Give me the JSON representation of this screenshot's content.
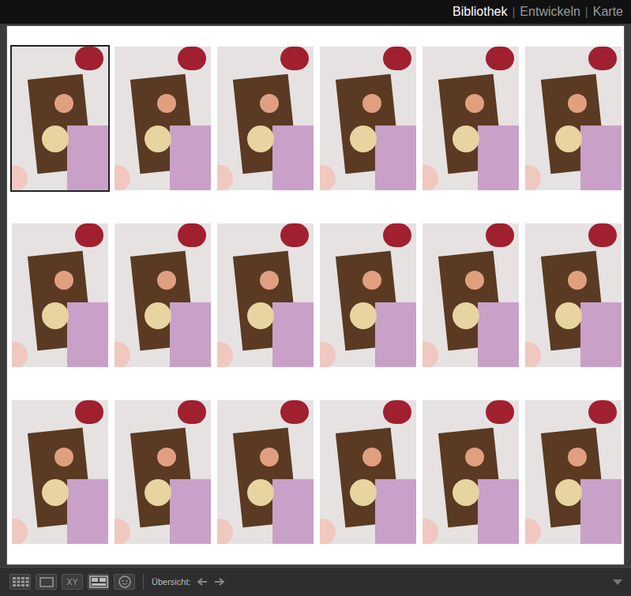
{
  "module_picker": {
    "separator": "|",
    "modules": [
      {
        "label": "Bibliothek",
        "selected": true
      },
      {
        "label": "Entwickeln",
        "selected": false
      },
      {
        "label": "Karte",
        "selected": false
      }
    ]
  },
  "grid": {
    "cells": [
      {
        "selected": true
      },
      {
        "selected": false
      },
      {
        "selected": false
      },
      {
        "selected": false
      },
      {
        "selected": false
      },
      {
        "selected": false
      },
      {
        "selected": false
      },
      {
        "selected": false
      },
      {
        "selected": false
      },
      {
        "selected": false
      },
      {
        "selected": false
      },
      {
        "selected": false
      },
      {
        "selected": false
      },
      {
        "selected": false
      },
      {
        "selected": false
      },
      {
        "selected": false
      },
      {
        "selected": false
      },
      {
        "selected": false
      }
    ]
  },
  "toolbar": {
    "view_buttons": [
      {
        "kind": "grid",
        "label": ""
      },
      {
        "kind": "loupe",
        "label": ""
      },
      {
        "kind": "compare",
        "label": "XY"
      },
      {
        "kind": "survey",
        "label": ""
      },
      {
        "kind": "people",
        "label": ""
      }
    ],
    "overview_label": "Übersicht:"
  }
}
